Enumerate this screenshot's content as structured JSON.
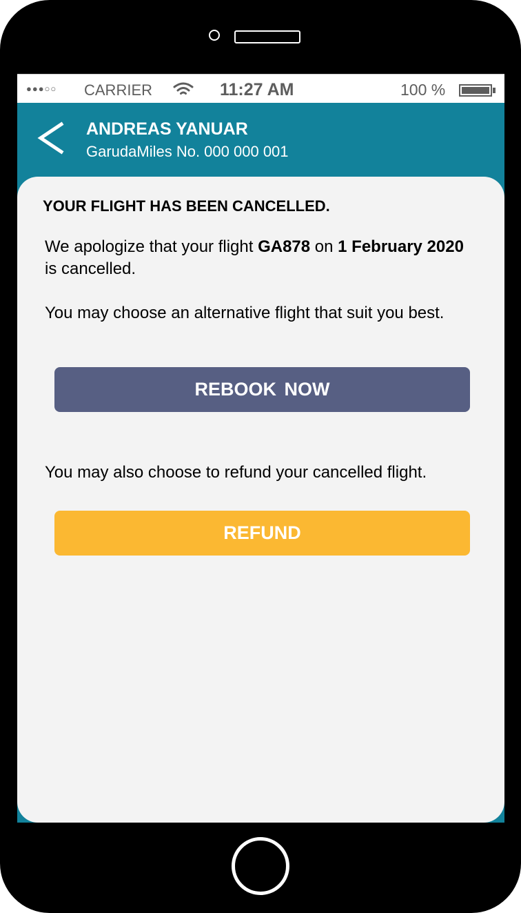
{
  "status_bar": {
    "signal_dots": "●●●○○",
    "carrier": "CARRIER",
    "wifi_icon": "wifi-icon",
    "time": "11:27 AM",
    "battery": "100 %"
  },
  "header": {
    "back_icon": "<",
    "name": "ANDREAS YANUAR",
    "miles_number": "GarudaMiles No. 000 000 001"
  },
  "content": {
    "title": "YOUR FLIGHT HAS BEEN CANCELLED.",
    "apology": {
      "before_flight": "We apologize that your flight ",
      "flight": "GA878",
      "middle": " on ",
      "date": "1 February 2020",
      "after": " is cancelled."
    },
    "alternative_text": "You may choose an alternative flight that suit you best.",
    "rebook_label": "REBOOK  NOW",
    "refund_text": "You may also choose to refund your cancelled flight.",
    "refund_label": "REFUND"
  },
  "colors": {
    "header_bg": "#12829b",
    "card_bg": "#f3f3f3",
    "rebook_button": "#575f83",
    "refund_button": "#fbb832"
  }
}
